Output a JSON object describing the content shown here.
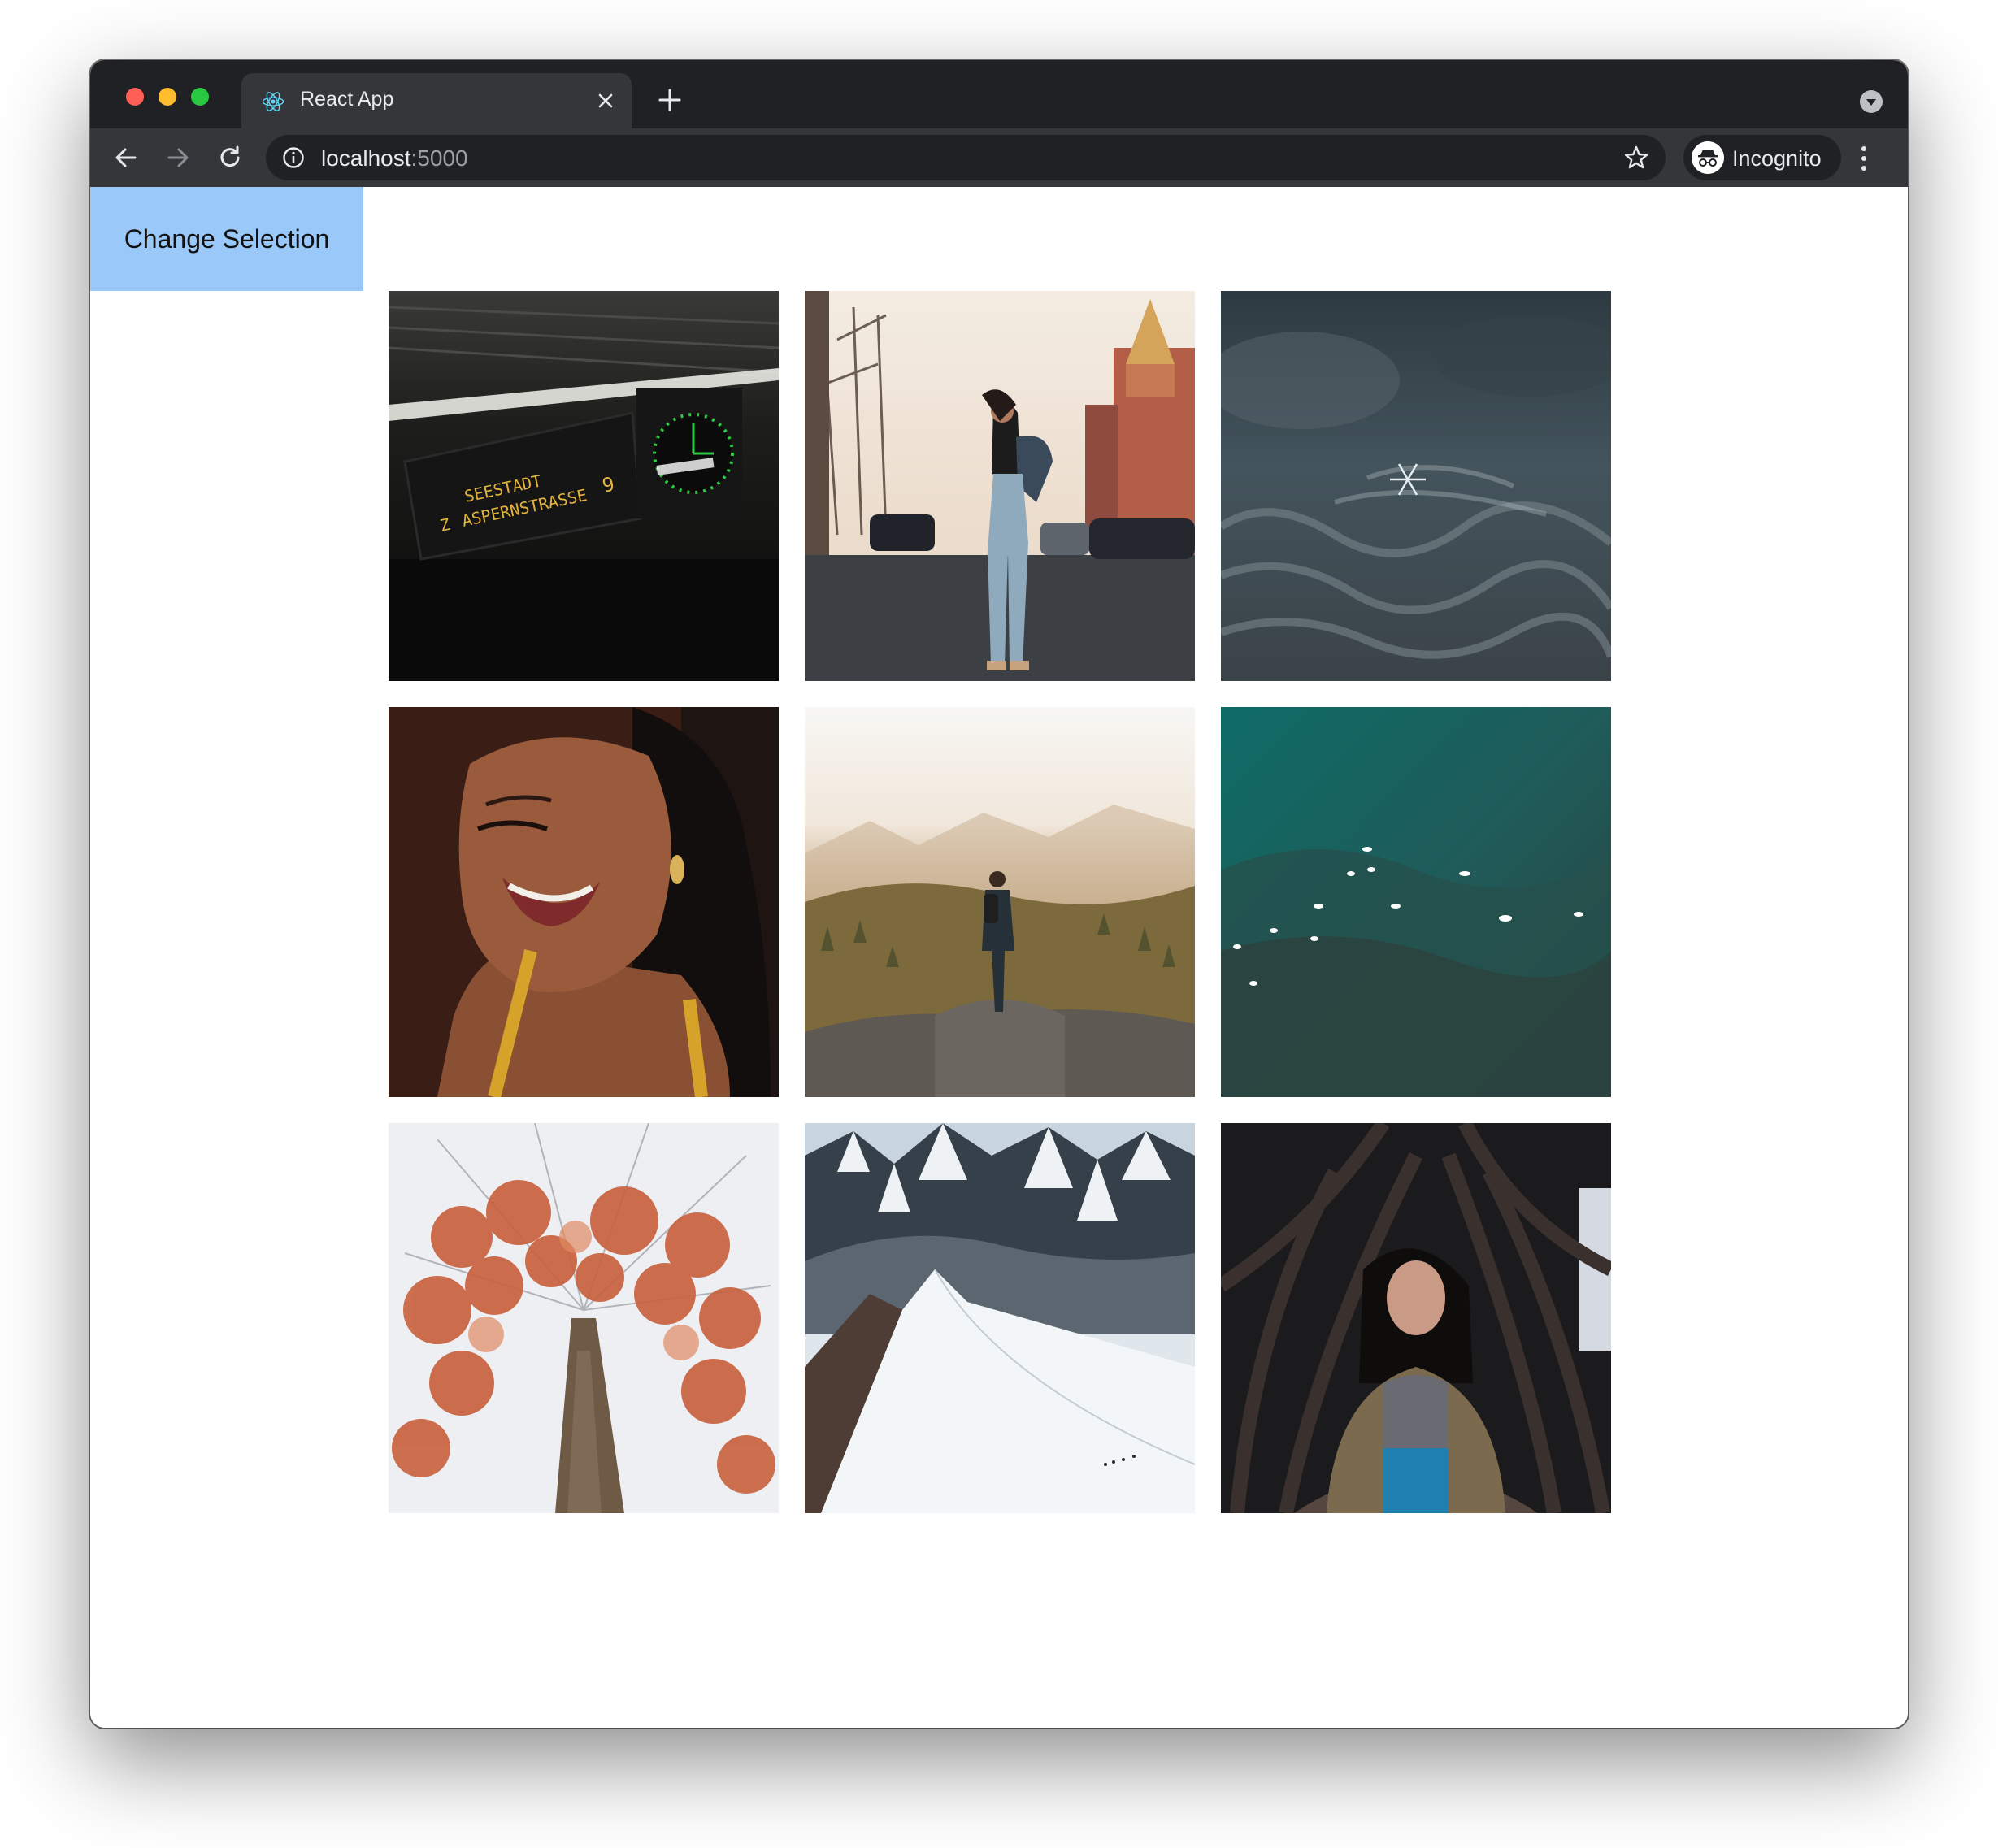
{
  "browser": {
    "tab_title": "React App",
    "url_host": "localhost",
    "url_port": ":5000",
    "profile_label": "Incognito"
  },
  "page": {
    "change_selection_label": "Change Selection",
    "photos": [
      {
        "subject": "subway-departure-board",
        "sign_lines": [
          "SEESTADT",
          "ASPERNSTRASSE"
        ],
        "sign_number": "9",
        "sign_line": "Z"
      },
      {
        "subject": "woman-on-city-street"
      },
      {
        "subject": "snowflake-on-fabric"
      },
      {
        "subject": "smiling-woman-portrait"
      },
      {
        "subject": "hiker-on-mountain-overlook"
      },
      {
        "subject": "aerial-ocean-surfers"
      },
      {
        "subject": "autumn-tree-from-below"
      },
      {
        "subject": "snowy-mountain-range"
      },
      {
        "subject": "woman-in-tree-tunnel"
      }
    ]
  },
  "colors": {
    "titlebar": "#202124",
    "toolbar": "#35363a",
    "button_bg": "#99c8f9"
  }
}
